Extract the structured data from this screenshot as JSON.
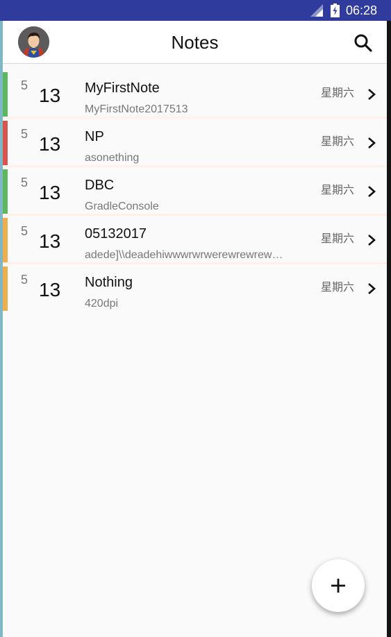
{
  "status_bar": {
    "time": "06:28",
    "signal_icon": "signal-icon",
    "battery_icon": "battery-charging-icon"
  },
  "app_bar": {
    "title": "Notes",
    "avatar_icon": "superman-avatar-icon",
    "search_icon": "search-icon"
  },
  "notes": [
    {
      "month": "5",
      "day": "13",
      "title": "MyFirstNote",
      "subtitle": "MyFirstNote2017513",
      "weekday": "星期六",
      "color": "#5cb85c"
    },
    {
      "month": "5",
      "day": "13",
      "title": "NP",
      "subtitle": "asonething",
      "weekday": "星期六",
      "color": "#d9534f"
    },
    {
      "month": "5",
      "day": "13",
      "title": "DBC",
      "subtitle": "GradleConsole",
      "weekday": "星期六",
      "color": "#5cb85c"
    },
    {
      "month": "5",
      "day": "13",
      "title": "05132017",
      "subtitle": "adede]\\\\deadehiwwwrwrwerewrewrewre...",
      "weekday": "星期六",
      "color": "#f0ad4e"
    },
    {
      "month": "5",
      "day": "13",
      "title": "Nothing",
      "subtitle": "420dpi",
      "weekday": "星期六",
      "color": "#f0ad4e"
    }
  ],
  "fab": {
    "icon": "plus-icon"
  },
  "colors": {
    "status_bar": "#2f3c9e",
    "background": "#fafafa",
    "divider": "#fff1ea"
  }
}
